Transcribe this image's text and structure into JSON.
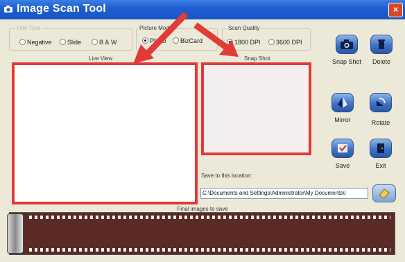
{
  "window": {
    "title": "Image Scan Tool",
    "close_label": "×"
  },
  "film_type": {
    "label": "Film Type",
    "options": [
      {
        "label": "Negative",
        "selected": false
      },
      {
        "label": "Slide",
        "selected": false
      },
      {
        "label": "B & W",
        "selected": false
      }
    ]
  },
  "picture_mode": {
    "label": "Picture Mode",
    "options": [
      {
        "label": "Photo",
        "selected": true
      },
      {
        "label": "BizCard",
        "selected": false
      }
    ]
  },
  "scan_quality": {
    "label": "Scan Quality",
    "options": [
      {
        "label": "1800 DPI",
        "selected": true
      },
      {
        "label": "3600 DPI",
        "selected": false
      }
    ]
  },
  "live_view_label": "Live View",
  "snap_shot_label": "Snap Shot",
  "buttons": {
    "snap_shot": "Snap Shot",
    "delete": "Delete",
    "mirror": "Mirror",
    "rotate": "Rotate",
    "save": "Save",
    "exit": "Exit"
  },
  "save_location": {
    "label": "Save to this location:",
    "value": "C:\\Documents and Settings\\Administrator\\My Documents\\I"
  },
  "final_images_label": "Final images to save",
  "colors": {
    "highlight_red": "#e23a36",
    "titlebar_blue": "#1f5fd1",
    "film_brown": "#5b2a24"
  }
}
